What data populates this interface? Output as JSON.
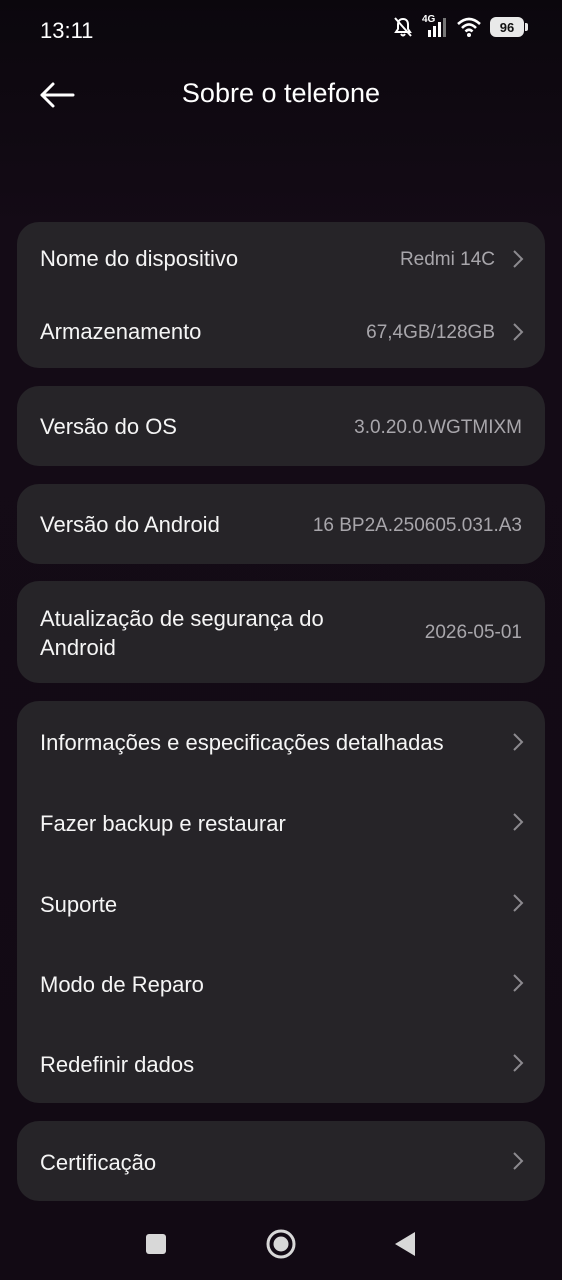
{
  "status": {
    "time": "13:11",
    "network": "4G",
    "battery": "96"
  },
  "header": {
    "title": "Sobre o telefone"
  },
  "card1": {
    "items": [
      {
        "label": "Nome do dispositivo",
        "value": "Redmi 14C"
      },
      {
        "label": "Armazenamento",
        "value": "67,4GB/128GB"
      }
    ]
  },
  "card2": {
    "label": "Versão do OS",
    "value": "3.0.20.0.WGTMIXM"
  },
  "card3": {
    "label": "Versão do Android",
    "value": "16 BP2A.250605.031.A3"
  },
  "card4": {
    "label_line1": "Atualização de segurança do",
    "label_line2": "Android",
    "value": "2026-05-01"
  },
  "card5": {
    "items": [
      {
        "label": "Informações e especificações detalhadas"
      },
      {
        "label": "Fazer backup e restaurar"
      },
      {
        "label": "Suporte"
      },
      {
        "label": "Modo de Reparo"
      },
      {
        "label": "Redefinir dados"
      }
    ]
  },
  "card6": {
    "label": "Certificação"
  },
  "icons": {
    "back": "arrow-left-icon",
    "chevron": "chevron-right-icon",
    "nav": [
      "recents-square-icon",
      "home-circle-icon",
      "back-triangle-icon"
    ]
  },
  "colors": {
    "card": "#262428",
    "value_text": "#a8a6ab"
  }
}
